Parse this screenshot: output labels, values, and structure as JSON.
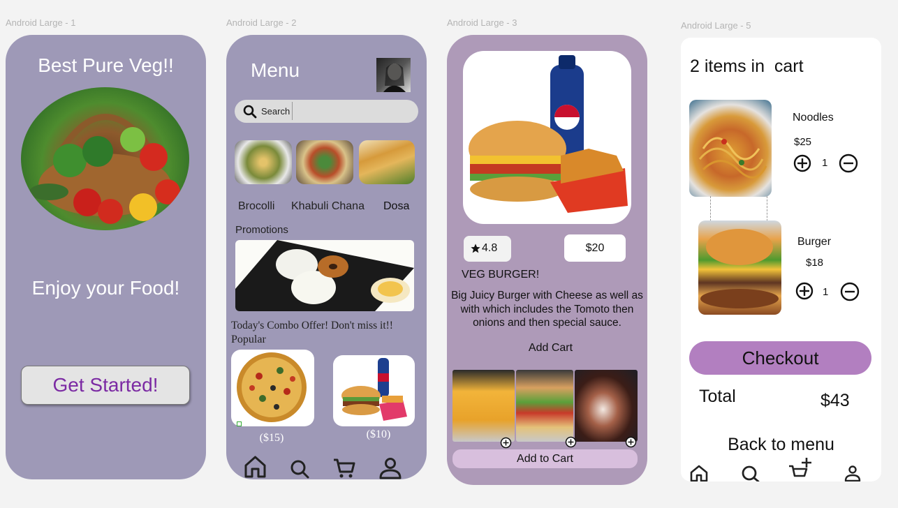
{
  "frames": {
    "f1": "Android Large - 1",
    "f2": "Android Large - 2",
    "f3": "Android Large - 3",
    "f5": "Android Large - 5"
  },
  "screen1": {
    "title": "Best Pure Veg!!",
    "tagline": "Enjoy your Food!",
    "button": "Get Started!",
    "colors": {
      "bg": "#9e99b7",
      "button_text": "#7b2aa3"
    }
  },
  "screen2": {
    "title": "Menu",
    "search_placeholder": "Search",
    "categories": [
      "Brocolli",
      "Khabuli Chana",
      "Dosa"
    ],
    "promotions_label": "Promotions",
    "combo_text": "Today's Combo Offer! Don't miss it!!",
    "popular_label": "Popular",
    "popular_prices": [
      "($15)",
      "($10)"
    ],
    "colors": {
      "bg": "#9e99b7"
    }
  },
  "screen3": {
    "rating": "4.8",
    "price": "$20",
    "name": "VEG BURGER!",
    "description": "Big Juicy Burger with Cheese as well as with which includes the Tomoto then onions and then special sauce.",
    "add_cart": "Add Cart",
    "add_to_cart": "Add to Cart",
    "colors": {
      "bg": "#ae9ab8",
      "button": "#d8bfdd"
    }
  },
  "screen5": {
    "title": "2 items in  cart",
    "items": [
      {
        "name": "Noodles",
        "price": "$25",
        "qty": "1"
      },
      {
        "name": "Burger",
        "price": "$18",
        "qty": "1"
      }
    ],
    "checkout": "Checkout",
    "total_label": "Total",
    "total_value": "$43",
    "back": "Back to menu",
    "colors": {
      "checkout": "#b27fc0"
    }
  }
}
